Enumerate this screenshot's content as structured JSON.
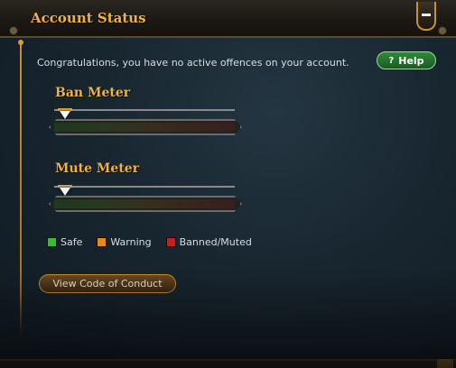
{
  "window": {
    "title": "Account Status"
  },
  "message": "Congratulations, you have no active offences on your account.",
  "help_button": {
    "label": "Help",
    "icon": "question-mark-icon"
  },
  "meters": [
    {
      "title": "Ban Meter",
      "level": 0
    },
    {
      "title": "Mute Meter",
      "level": 0
    }
  ],
  "legend": [
    {
      "label": "Safe",
      "color": "#2fbf2f"
    },
    {
      "label": "Warning",
      "color": "#e88a1a"
    },
    {
      "label": "Banned/Muted",
      "color": "#c81e1e"
    }
  ],
  "conduct_button": {
    "label": "View Code of Conduct"
  },
  "colors": {
    "accent_gold": "#f0b33a",
    "help_green": "#2f8a3a"
  }
}
